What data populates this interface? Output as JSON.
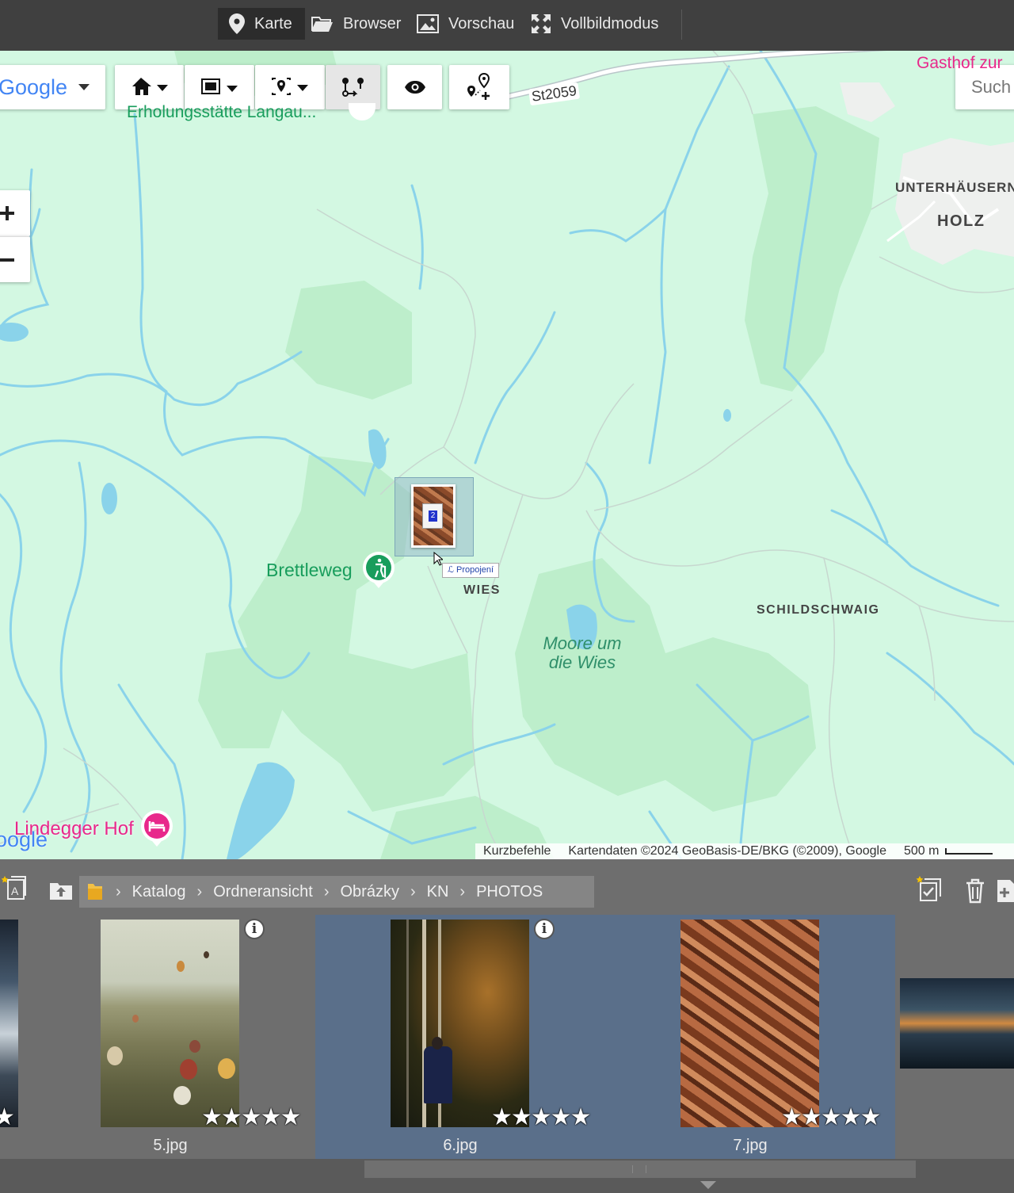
{
  "topbar": {
    "tabs": [
      {
        "label": "Karte",
        "icon": "map-pin-icon",
        "active": true
      },
      {
        "label": "Browser",
        "icon": "folder-open-icon",
        "active": false
      },
      {
        "label": "Vorschau",
        "icon": "image-icon",
        "active": false
      },
      {
        "label": "Vollbildmodus",
        "icon": "fullscreen-icon",
        "active": false
      }
    ]
  },
  "map": {
    "provider_label": "Google",
    "search_placeholder": "Such",
    "toolbar_icons": [
      "home-icon",
      "fit-bounds-icon",
      "location-select-icon",
      "track-route-icon",
      "eye-icon",
      "add-location-icon"
    ],
    "labels": {
      "road": "St2059",
      "gasthof": "Gasthof zur",
      "erholung": "Erholungsstätte Langau...",
      "unterhausern": "UNTERHÄUSERN",
      "holz": "HOLZ",
      "brettleweg": "Brettleweg",
      "wies": "WIES",
      "moore_line1": "Moore um",
      "moore_line2": "die Wies",
      "schildschwaig": "SCHILDSCHWAIG",
      "lindegger": "Lindegger Hof",
      "google_logo": "oogle"
    },
    "marker": {
      "count": "2",
      "tooltip": "Propojení"
    },
    "footer": {
      "shortcuts": "Kurzbefehle",
      "attribution": "Kartendaten ©2024 GeoBasis-DE/BKG (©2009), Google",
      "scale": "500 m"
    },
    "colors": {
      "land": "#d3f8e2",
      "forest": "#bdeecb",
      "water": "#8ad3ea",
      "road": "#ffffff",
      "poi_pink": "#e8288b",
      "poi_green": "#189d5c"
    }
  },
  "pathbar": {
    "crumbs": [
      "Katalog",
      "Ordneransicht",
      "Obrázky",
      "KN",
      "PHOTOS"
    ]
  },
  "thumbnails": [
    {
      "name": "5.jpg",
      "rating": 5,
      "selected": false,
      "info": true
    },
    {
      "name": "6.jpg",
      "rating": 5,
      "selected": true,
      "info": true
    },
    {
      "name": "7.jpg",
      "rating": 5,
      "selected": true,
      "info": false
    }
  ],
  "stars_text": "★★★★★"
}
